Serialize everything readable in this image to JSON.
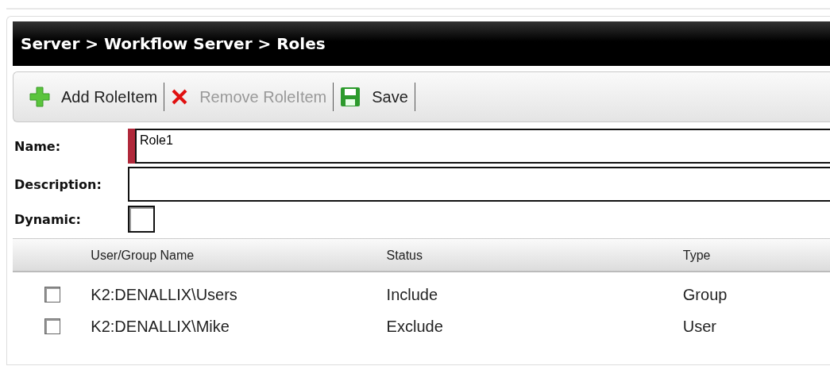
{
  "header": {
    "breadcrumb": "Server > Workflow Server > Roles"
  },
  "toolbar": [
    {
      "kind": "add",
      "label": "Add RoleItem",
      "disabled": false
    },
    {
      "kind": "remove",
      "label": "Remove RoleItem",
      "disabled": true
    },
    {
      "kind": "save",
      "label": "Save",
      "disabled": false
    }
  ],
  "form": {
    "name": {
      "label": "Name:",
      "value": "Role1",
      "required": true
    },
    "description": {
      "label": "Description:"
    },
    "dynamic": {
      "label": "Dynamic:",
      "checked": false
    }
  },
  "table": {
    "columns": [
      "User/Group Name",
      "Status",
      "Type"
    ],
    "rows": [
      {
        "selected": false,
        "cells": [
          "K2:DENALLIX\\Users",
          "Include",
          "Group"
        ]
      },
      {
        "selected": false,
        "cells": [
          "K2:DENALLIX\\Mike",
          "Exclude",
          "User"
        ]
      }
    ]
  }
}
